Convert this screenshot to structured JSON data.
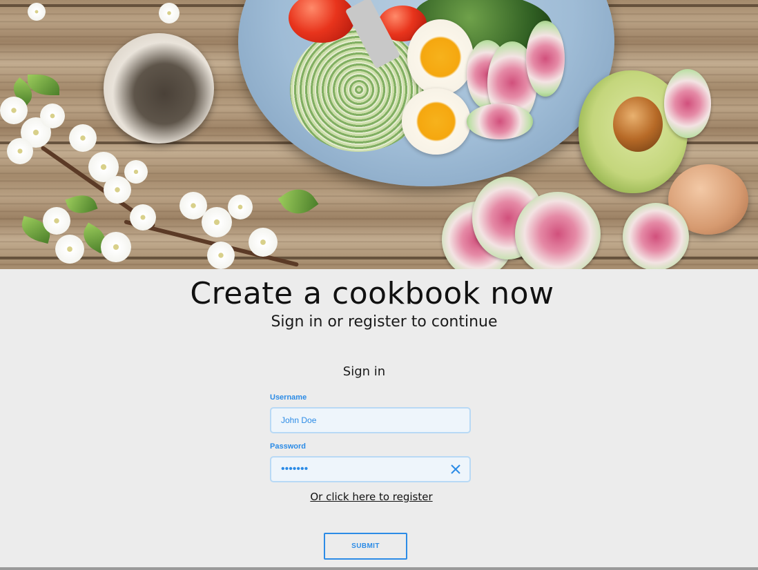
{
  "hero": {
    "image_description_icon": "food-photo"
  },
  "heading": {
    "title": "Create a cookbook now",
    "subtitle": "Sign in or register to continue"
  },
  "signin": {
    "heading": "Sign in",
    "username_label": "Username",
    "username_value": "John Doe",
    "password_label": "Password",
    "password_value": "•••••••",
    "register_link": "Or click here to register",
    "submit_label": "SUBMIT"
  },
  "colors": {
    "accent": "#2b8be6",
    "background": "#ececec",
    "field_bg": "#eef5fb",
    "field_border": "#b8d9f5"
  }
}
